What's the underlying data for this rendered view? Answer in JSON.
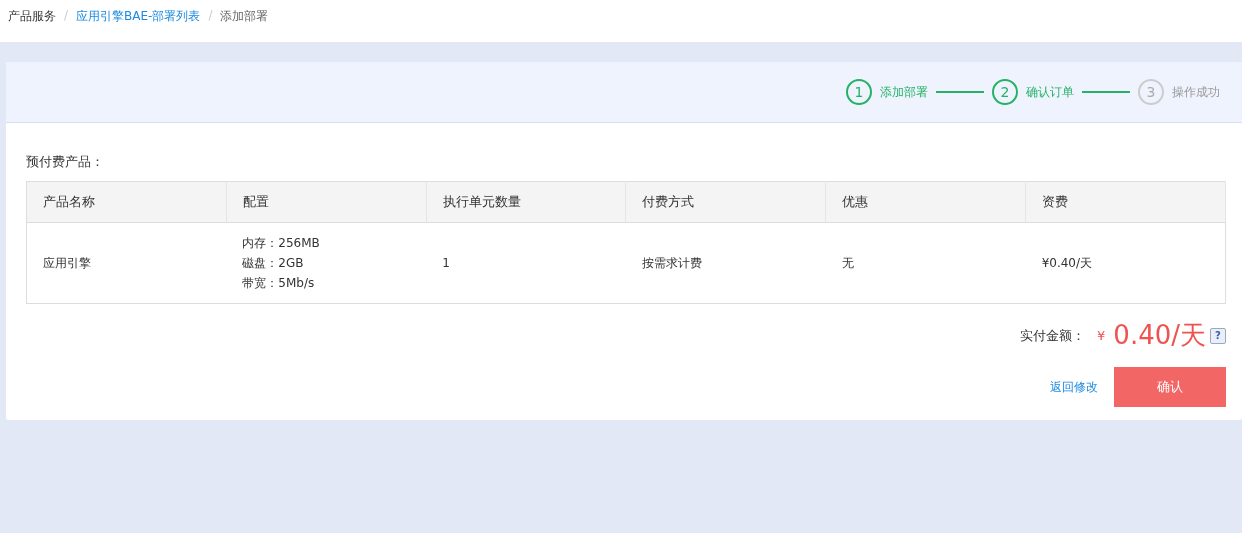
{
  "breadcrumb": {
    "separator": "/",
    "items": [
      {
        "label": "产品服务",
        "link": false
      },
      {
        "label": "应用引擎BAE-部署列表",
        "link": true
      },
      {
        "label": "添加部署",
        "link": false
      }
    ]
  },
  "steps": [
    {
      "number": "1",
      "label": "添加部署",
      "done": true
    },
    {
      "number": "2",
      "label": "确认订单",
      "done": true
    },
    {
      "number": "3",
      "label": "操作成功",
      "done": false
    }
  ],
  "section_title": "预付费产品：",
  "table": {
    "columns": [
      "产品名称",
      "配置",
      "执行单元数量",
      "付费方式",
      "优惠",
      "资费"
    ],
    "rows": [
      {
        "cells": [
          "应用引擎",
          [
            "内存：256MB",
            "磁盘：2GB",
            "带宽：5Mb/s"
          ],
          "1",
          "按需求计费",
          "无",
          "¥0.40/天"
        ]
      }
    ]
  },
  "total": {
    "label": "实付金额：",
    "currency": "¥",
    "amount": "0.40/天",
    "help": "?"
  },
  "actions": {
    "back": "返回修改",
    "confirm": "确认"
  }
}
